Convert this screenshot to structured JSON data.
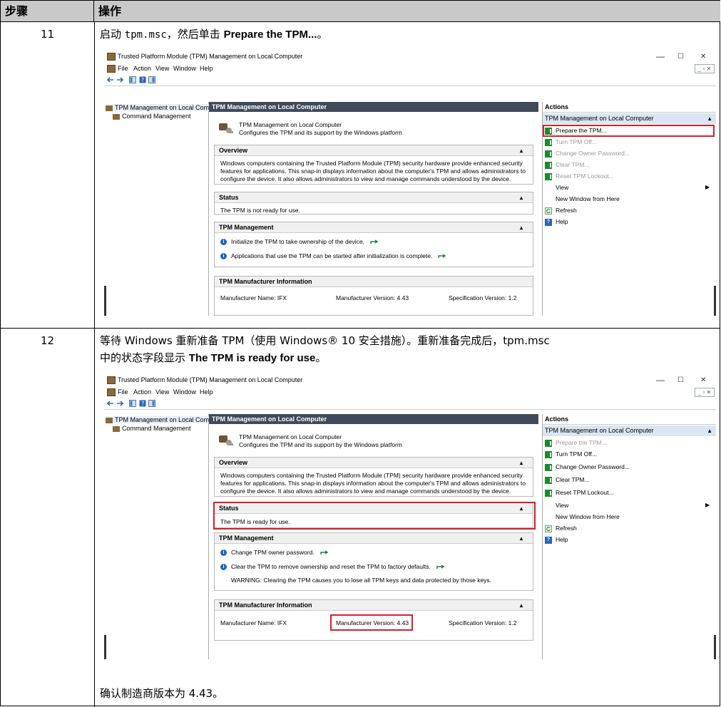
{
  "table": {
    "header": {
      "step": "步骤",
      "action": "操作"
    },
    "rows": [
      {
        "step": "11",
        "text_pre": "启动 ",
        "code": "tpm.msc",
        "text_mid": "，然后单击 ",
        "bold": "Prepare the TPM...",
        "text_post": "。"
      },
      {
        "step": "12",
        "line1": "等待 Windows 重新准备 TPM（使用 Windows® 10 安全措施）。重新准备完成后，tpm.msc",
        "line2_pre": "中的状态字段显示 ",
        "line2_bold": "The TPM is ready for use",
        "line2_post": "。",
        "footer": "确认制造商版本为 4.43。"
      }
    ]
  },
  "window": {
    "title": "Trusted Platform Module (TPM) Management on Local Computer",
    "controls": {
      "min": "—",
      "max": "☐",
      "close": "✕"
    },
    "menu": [
      "File",
      "Action",
      "View",
      "Window",
      "Help"
    ],
    "mdi_controls": "_ ▫ ✕"
  },
  "tree": {
    "root": "TPM Management on Local Comp",
    "child": "Command Management"
  },
  "center": {
    "header": "TPM Management on Local Computer",
    "intro_title": "TPM Management on Local Computer",
    "intro_sub": "Configures the TPM and its support by the Windows platform",
    "overview_title": "Overview",
    "overview_text": "Windows computers containing the Trusted Platform Module (TPM) security hardware provide enhanced security features for applications. This snap-in displays information about the computer's TPM and allows administrators to configure the device. It also allows administrators to view and manage commands understood by the device.",
    "status_title": "Status",
    "tpm_mgmt_title": "TPM Management",
    "mfr_title": "TPM Manufacturer Information",
    "mfr_name": "Manufacturer Name:  IFX",
    "mfr_version": "Manufacturer Version:  4.43",
    "spec_version": "Specification Version:  1.2"
  },
  "shot1": {
    "status_text": "The TPM is not ready for use.",
    "mgmt_items": [
      "Initialize the TPM to take ownership of the device.",
      "Applications that use the TPM can be started after initialization is complete."
    ]
  },
  "shot2": {
    "status_text": "The TPM is ready for use.",
    "mgmt_items": [
      "Change TPM owner password.",
      "Clear the TPM to remove ownership and reset the TPM to factory defaults."
    ],
    "warning": "WARNING: Clearing the TPM causes you to lose all TPM keys and data protected by those keys."
  },
  "actions": {
    "header": "Actions",
    "sub": "TPM Management on Local Computer",
    "items": [
      "Prepare the TPM...",
      "Turn TPM Off...",
      "Change Owner Password...",
      "Clear TPM...",
      "Reset TPM Lockout...",
      "View",
      "New Window from Here",
      "Refresh",
      "Help"
    ]
  },
  "colors": {
    "accent_red": "#d6202a",
    "header_gray": "#c9c9c9",
    "pane_header": "#3f4b5b",
    "action_green": "#1c8a2e"
  }
}
